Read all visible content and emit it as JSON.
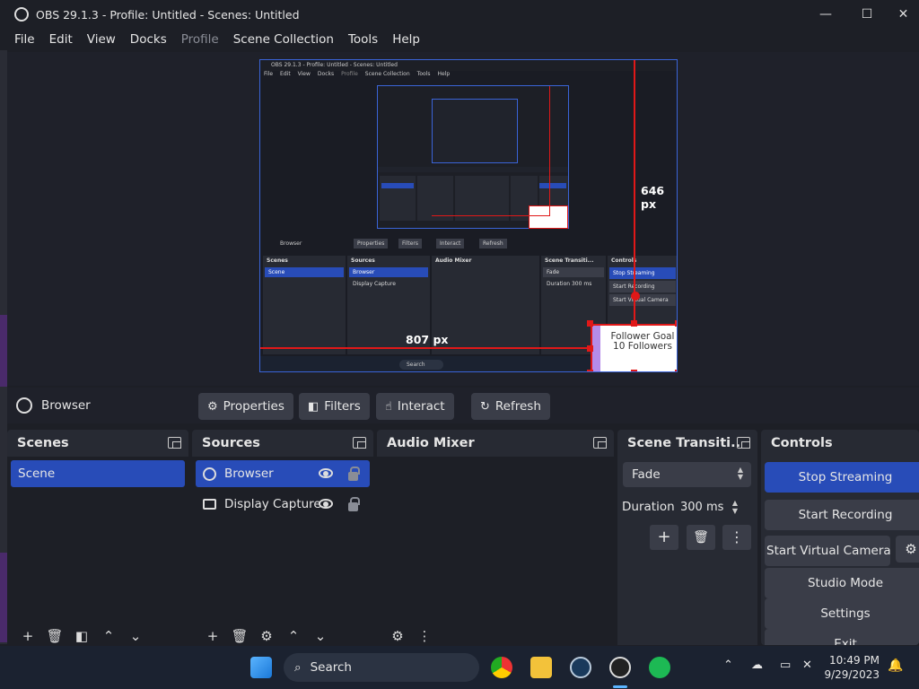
{
  "window": {
    "title": "OBS 29.1.3 - Profile: Untitled - Scenes: Untitled",
    "minimize": "—",
    "maximize": "☐",
    "close": "✕"
  },
  "menu": [
    "File",
    "Edit",
    "View",
    "Docks",
    "Profile",
    "Scene Collection",
    "Tools",
    "Help"
  ],
  "preview": {
    "width_label": "646 px",
    "height_label": "807 px",
    "nested_title": "OBS 29.1.3 - Profile: Untitled - Scenes: Untitled",
    "nested_menu": [
      "File",
      "Edit",
      "View",
      "Docks",
      "Profile",
      "Scene Collection",
      "Tools",
      "Help"
    ],
    "nested_source": "Browser",
    "nested_buttons": [
      "Properties",
      "Filters",
      "Interact",
      "Refresh"
    ],
    "nested_docks": [
      "Scenes",
      "Sources",
      "Audio Mixer",
      "Scene Transiti...",
      "Controls"
    ],
    "nested_scene": "Scene",
    "nested_sources": [
      "Browser",
      "Display Capture"
    ],
    "nested_fade": "Fade",
    "nested_duration_label": "Duration",
    "nested_duration": "300 ms",
    "nested_controls": [
      "Stop Streaming",
      "Start Recording",
      "Start Virtual Camera"
    ],
    "nested_search": "Search",
    "follower_goal_text": "Follower Goal 10 Followers"
  },
  "sourcebar": {
    "current_source": "Browser",
    "buttons": [
      "Properties",
      "Filters",
      "Interact",
      "Refresh"
    ]
  },
  "docks": {
    "scenes": {
      "title": "Scenes",
      "items": [
        "Scene"
      ]
    },
    "sources": {
      "title": "Sources",
      "items": [
        "Browser",
        "Display Capture"
      ]
    },
    "audio": {
      "title": "Audio Mixer"
    },
    "transitions": {
      "title": "Scene Transiti...",
      "transition": "Fade",
      "duration_label": "Duration",
      "duration": "300 ms"
    },
    "controls": {
      "title": "Controls",
      "buttons": [
        "Stop Streaming",
        "Start Recording",
        "Start Virtual Camera",
        "Studio Mode",
        "Settings",
        "Exit"
      ]
    }
  },
  "taskbar": {
    "search": "Search",
    "time": "10:49 PM",
    "date": "9/29/2023"
  },
  "colors": {
    "accent": "#284cb8",
    "red": "#e01818",
    "panel": "#272a33"
  }
}
